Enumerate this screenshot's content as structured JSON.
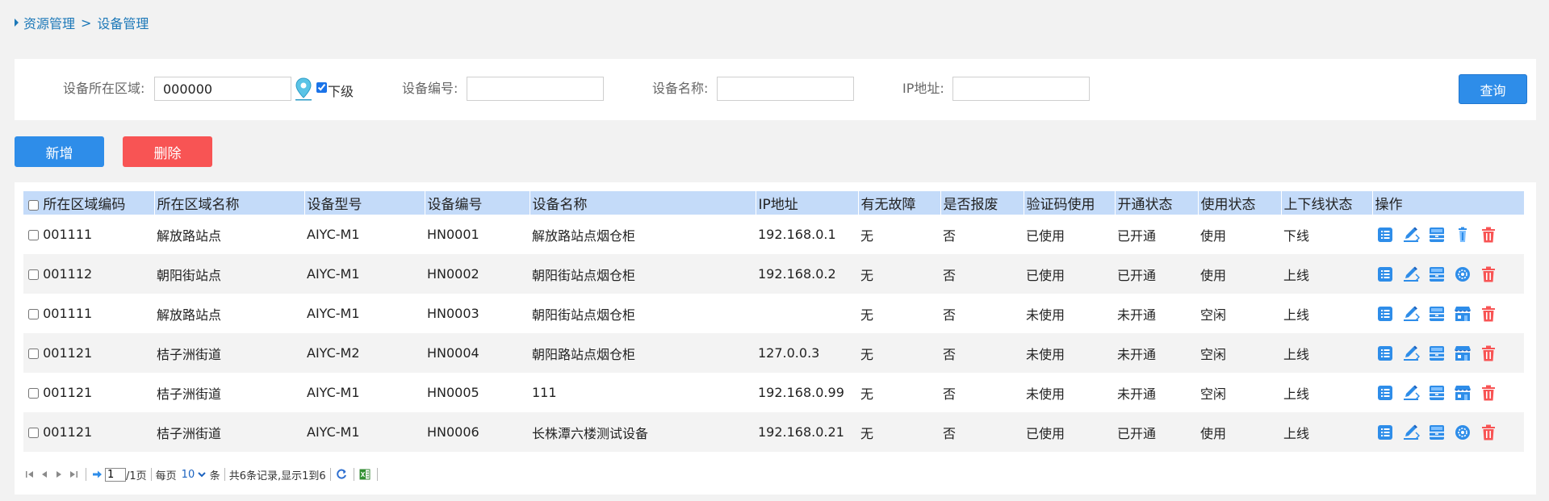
{
  "breadcrumb": {
    "parent": "资源管理",
    "separator": ">",
    "current": "设备管理"
  },
  "search": {
    "region_label": "设备所在区域:",
    "region_value": "000000",
    "sub_level_label": "下级",
    "sub_level_checked": true,
    "device_no_label": "设备编号:",
    "device_no_value": "",
    "device_name_label": "设备名称:",
    "device_name_value": "",
    "ip_label": "IP地址:",
    "ip_value": "",
    "query_label": "查询"
  },
  "toolbar": {
    "add_label": "新增",
    "delete_label": "删除"
  },
  "table": {
    "headers": [
      "所在区域编码",
      "所在区域名称",
      "设备型号",
      "设备编号",
      "设备名称",
      "IP地址",
      "有无故障",
      "是否报废",
      "验证码使用",
      "开通状态",
      "使用状态",
      "上下线状态",
      "操作"
    ],
    "rows": [
      {
        "region_code": "001111",
        "region_name": "解放路站点",
        "model": "AIYC-M1",
        "device_no": "HN0001",
        "device_name": "解放路站点烟仓柜",
        "ip": "192.168.0.1",
        "fault": "无",
        "scrapped": "否",
        "code_used": "已使用",
        "opened": "已开通",
        "usage": "使用",
        "online": "下线",
        "ops": [
          "list-icon",
          "edit-icon",
          "cabinet-icon",
          "trash-small-icon",
          "delete-icon"
        ]
      },
      {
        "region_code": "001112",
        "region_name": "朝阳街站点",
        "model": "AIYC-M1",
        "device_no": "HN0002",
        "device_name": "朝阳街站点烟仓柜",
        "ip": "192.168.0.2",
        "fault": "无",
        "scrapped": "否",
        "code_used": "已使用",
        "opened": "已开通",
        "usage": "使用",
        "online": "上线",
        "ops": [
          "list-icon",
          "edit-icon",
          "cabinet-icon",
          "settings-circle-icon",
          "delete-icon"
        ]
      },
      {
        "region_code": "001111",
        "region_name": "解放路站点",
        "model": "AIYC-M1",
        "device_no": "HN0003",
        "device_name": "朝阳街站点烟仓柜",
        "ip": "",
        "fault": "无",
        "scrapped": "否",
        "code_used": "未使用",
        "opened": "未开通",
        "usage": "空闲",
        "online": "上线",
        "ops": [
          "list-icon",
          "edit-icon",
          "cabinet-icon",
          "store-icon",
          "delete-icon"
        ]
      },
      {
        "region_code": "001121",
        "region_name": "桔子洲街道",
        "model": "AIYC-M2",
        "device_no": "HN0004",
        "device_name": "朝阳路站点烟仓柜",
        "ip": "127.0.0.3",
        "fault": "无",
        "scrapped": "否",
        "code_used": "未使用",
        "opened": "未开通",
        "usage": "空闲",
        "online": "上线",
        "ops": [
          "list-icon",
          "edit-icon",
          "cabinet-icon",
          "store-icon",
          "delete-icon"
        ]
      },
      {
        "region_code": "001121",
        "region_name": "桔子洲街道",
        "model": "AIYC-M1",
        "device_no": "HN0005",
        "device_name": "111",
        "ip": "192.168.0.99",
        "fault": "无",
        "scrapped": "否",
        "code_used": "未使用",
        "opened": "未开通",
        "usage": "空闲",
        "online": "上线",
        "ops": [
          "list-icon",
          "edit-icon",
          "cabinet-icon",
          "store-icon",
          "delete-icon"
        ]
      },
      {
        "region_code": "001121",
        "region_name": "桔子洲街道",
        "model": "AIYC-M1",
        "device_no": "HN0006",
        "device_name": "长株潭六楼测试设备",
        "ip": "192.168.0.21",
        "fault": "无",
        "scrapped": "否",
        "code_used": "已使用",
        "opened": "已开通",
        "usage": "使用",
        "online": "上线",
        "ops": [
          "list-icon",
          "edit-icon",
          "cabinet-icon",
          "settings-circle-icon",
          "delete-icon"
        ]
      }
    ]
  },
  "pager": {
    "current_page": "1",
    "total_pages": "/1页",
    "per_page_label": "每页",
    "page_size": "10",
    "unit": "条",
    "summary": "共6条记录,显示1到6"
  },
  "colors": {
    "primary": "#2e8de9",
    "danger": "#f85454",
    "header_bg": "#c4dbf9",
    "link": "#1c78b8"
  }
}
